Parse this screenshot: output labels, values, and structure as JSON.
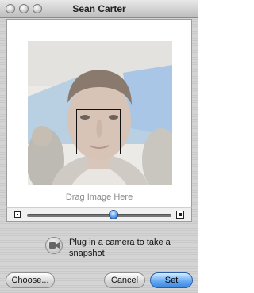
{
  "window": {
    "title": "Sean Carter"
  },
  "editor": {
    "drag_hint": "Drag Image Here",
    "zoom_fraction": 0.6
  },
  "camera": {
    "message": "Plug in a camera to take a snapshot"
  },
  "buttons": {
    "choose": "Choose...",
    "cancel": "Cancel",
    "set": "Set"
  },
  "colors": {
    "accent": "#3b86de"
  }
}
